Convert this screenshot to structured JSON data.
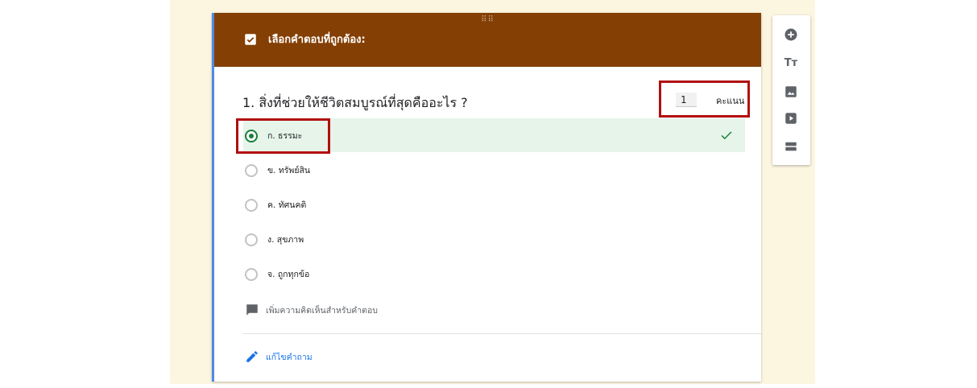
{
  "section_header": {
    "title": "เลือกคำตอบที่ถูกต้อง:",
    "color": "#843f04"
  },
  "question": {
    "text": "1. สิ่งที่ช่วยให้ชีวิตสมบูรณ์ที่สุดคืออะไร ?",
    "points_value": "1",
    "points_label": "คะแนน"
  },
  "options": [
    {
      "label": "ก. ธรรมะ",
      "selected": true,
      "correct": true
    },
    {
      "label": "ข. ทรัพย์สิน",
      "selected": false
    },
    {
      "label": "ค. ทัศนคติ",
      "selected": false
    },
    {
      "label": "ง. สุขภาพ",
      "selected": false
    },
    {
      "label": "จ. ถูกทุกข้อ",
      "selected": false
    }
  ],
  "feedback": {
    "label": "เพิ่มความคิดเห็นสำหรับคำตอบ",
    "icon": "comment-icon"
  },
  "edit": {
    "label": "แก้ไขคำถาม",
    "icon": "pencil-icon"
  },
  "toolbar": {
    "items": [
      {
        "name": "add-question",
        "icon": "plus-circle-icon"
      },
      {
        "name": "add-title",
        "icon": "title-text-icon",
        "text": "Tт"
      },
      {
        "name": "add-image",
        "icon": "image-icon"
      },
      {
        "name": "add-video",
        "icon": "video-icon"
      },
      {
        "name": "add-section",
        "icon": "section-icon"
      }
    ]
  },
  "colors": {
    "correct_green": "#188038",
    "highlight_red": "#b30e0e",
    "accent_blue": "#1a73e8"
  }
}
